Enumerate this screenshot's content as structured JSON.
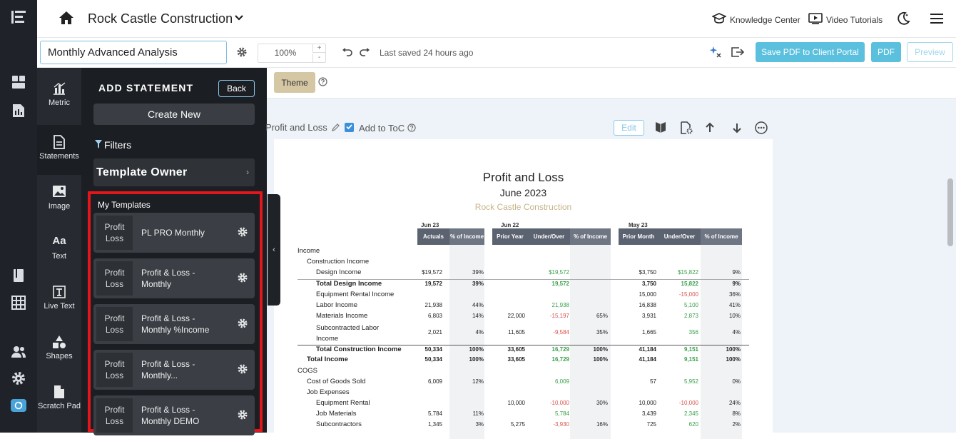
{
  "app": {
    "company": "Rock Castle Construction",
    "links": {
      "knowledge_center": "Knowledge Center",
      "video_tutorials": "Video Tutorials"
    }
  },
  "toolbar": {
    "report_name": "Monthly Advanced Analysis",
    "zoom": "100%",
    "zoom_plus": "+",
    "zoom_minus": "-",
    "last_saved": "Last saved 24 hours ago",
    "save_pdf_portal": "Save PDF to Client Portal",
    "pdf": "PDF",
    "preview": "Preview"
  },
  "icon_panel": [
    {
      "label": "Metric",
      "icon": "metric-icon"
    },
    {
      "label": "Statements",
      "icon": "statements-icon",
      "active": true
    },
    {
      "label": "Image",
      "icon": "image-icon"
    },
    {
      "label": "Text",
      "icon": "text-icon"
    },
    {
      "label": "Live Text",
      "icon": "live-text-icon"
    },
    {
      "label": "Shapes",
      "icon": "shapes-icon"
    },
    {
      "label": "Scratch Pad",
      "icon": "scratch-pad-icon"
    }
  ],
  "text_icon_glyph": "Aa",
  "add_statement": {
    "title": "ADD STATEMENT",
    "back": "Back",
    "create_new": "Create New",
    "filters": "Filters",
    "template_owner": "Template Owner",
    "chevron": "›",
    "my_templates": "My Templates",
    "templates": [
      {
        "thumb": "Profit Loss",
        "name": "PL PRO Monthly"
      },
      {
        "thumb": "Profit Loss",
        "name": "Profit & Loss - Monthly"
      },
      {
        "thumb": "Profit Loss",
        "name": "Profit & Loss - Monthly %Income"
      },
      {
        "thumb": "Profit Loss",
        "name": "Profit & Loss - Monthly..."
      },
      {
        "thumb": "Profit Loss",
        "name": "Profit & Loss - Monthly DEMO"
      }
    ]
  },
  "canvas": {
    "theme": "Theme",
    "section_label": "Profit and Loss",
    "toc_label": "Add to ToC",
    "toc_checked": true,
    "edit": "Edit",
    "collapse_glyph": "‹"
  },
  "report": {
    "title": "Profit and Loss",
    "subtitle": "June 2023",
    "company": "Rock Castle Construction",
    "groups": [
      "Jun 23",
      "Jun 22",
      "May 23"
    ],
    "columns": [
      "Actuals",
      "% of Income",
      "Prior Year",
      "Under/Over",
      "% of Income",
      "Prior Month",
      "Under/Over",
      "% of Income"
    ],
    "rows": [
      {
        "label": "Income",
        "indent": 0,
        "bold": false,
        "values": [
          "",
          "",
          "",
          "",
          "",
          "",
          "",
          ""
        ]
      },
      {
        "label": "Construction Income",
        "indent": 1,
        "bold": false,
        "values": [
          "",
          "",
          "",
          "",
          "",
          "",
          "",
          ""
        ]
      },
      {
        "label": "Design Income",
        "indent": 2,
        "bold": false,
        "values": [
          "$19,572",
          "39%",
          "",
          "$19,572",
          "",
          "$3,750",
          "$15,822",
          "9%"
        ]
      },
      {
        "label": "Total Design Income",
        "indent": 2,
        "bold": true,
        "values": [
          "19,572",
          "39%",
          "",
          "19,572",
          "",
          "3,750",
          "15,822",
          "9%"
        ]
      },
      {
        "label": "Equipment Rental Income",
        "indent": 2,
        "bold": false,
        "values": [
          "",
          "",
          "",
          "",
          "",
          "15,000",
          "-15,000",
          "36%"
        ]
      },
      {
        "label": "Labor Income",
        "indent": 2,
        "bold": false,
        "values": [
          "21,938",
          "44%",
          "",
          "21,938",
          "",
          "16,838",
          "5,100",
          "41%"
        ]
      },
      {
        "label": "Materials Income",
        "indent": 2,
        "bold": false,
        "values": [
          "6,803",
          "14%",
          "22,000",
          "-15,197",
          "65%",
          "3,931",
          "2,873",
          "10%"
        ]
      },
      {
        "label": "Subcontracted Labor Income",
        "indent": 2,
        "bold": false,
        "values": [
          "2,021",
          "4%",
          "11,605",
          "-9,584",
          "35%",
          "1,665",
          "356",
          "4%"
        ]
      },
      {
        "label": "Total Construction Income",
        "indent": 2,
        "bold": true,
        "values": [
          "50,334",
          "100%",
          "33,605",
          "16,729",
          "100%",
          "41,184",
          "9,151",
          "100%"
        ]
      },
      {
        "label": "Total Income",
        "indent": 1,
        "bold": true,
        "values": [
          "50,334",
          "100%",
          "33,605",
          "16,729",
          "100%",
          "41,184",
          "9,151",
          "100%"
        ]
      },
      {
        "label": "COGS",
        "indent": 0,
        "bold": false,
        "values": [
          "",
          "",
          "",
          "",
          "",
          "",
          "",
          ""
        ]
      },
      {
        "label": "Cost of Goods Sold",
        "indent": 1,
        "bold": false,
        "values": [
          "6,009",
          "12%",
          "",
          "6,009",
          "",
          "57",
          "5,952",
          "0%"
        ]
      },
      {
        "label": "Job Expenses",
        "indent": 1,
        "bold": false,
        "values": [
          "",
          "",
          "",
          "",
          "",
          "",
          "",
          ""
        ]
      },
      {
        "label": "Equipment Rental",
        "indent": 2,
        "bold": false,
        "values": [
          "",
          "",
          "10,000",
          "-10,000",
          "30%",
          "10,000",
          "-10,000",
          "24%"
        ]
      },
      {
        "label": "Job Materials",
        "indent": 2,
        "bold": false,
        "values": [
          "5,784",
          "11%",
          "",
          "5,784",
          "",
          "3,439",
          "2,345",
          "8%"
        ]
      },
      {
        "label": "Subcontractors",
        "indent": 2,
        "bold": false,
        "values": [
          "1,345",
          "3%",
          "5,275",
          "-3,930",
          "16%",
          "725",
          "620",
          "2%"
        ]
      }
    ]
  },
  "colors": {
    "rail": "#1f2329",
    "panel": "#1b1e22",
    "accent_blue": "#5bc0de",
    "highlight_frame": "#e4151b",
    "positive": "#3aa04a",
    "negative": "#d9534f",
    "theme_button": "#d5c7a3"
  }
}
